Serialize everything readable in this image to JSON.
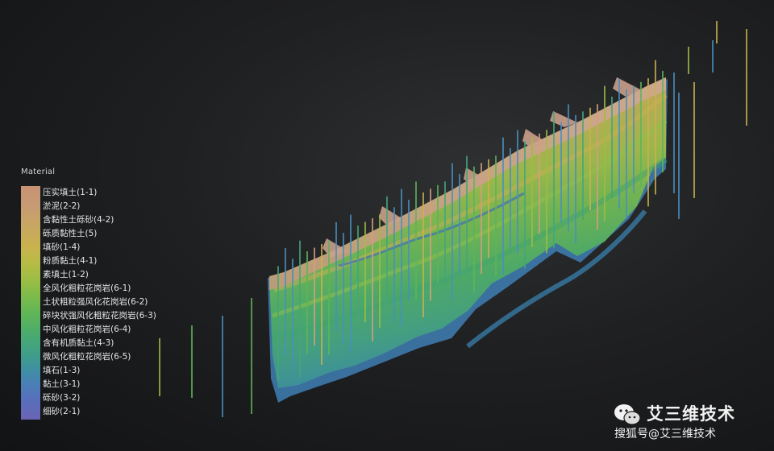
{
  "legend": {
    "title": "Material",
    "items": [
      "压实填土(1-1)",
      "淤泥(2-2)",
      "含黏性土砾砂(4-2)",
      "砾质黏性土(5)",
      "填砂(1-4)",
      "粉质黏土(4-1)",
      "素填土(1-2)",
      "全风化粗粒花岗岩(6-1)",
      "土状粗粒强风化花岗岩(6-2)",
      "碎块状强风化粗粒花岗岩(6-3)",
      "中风化粗粒花岗岩(6-4)",
      "含有机质黏土(4-3)",
      "微风化粗粒花岗岩(6-5)",
      "填石(1-3)",
      "黏土(3-1)",
      "砾砂(3-2)",
      "细砂(2-1)"
    ]
  },
  "watermark": {
    "brand": "艾三维技术",
    "sub": "搜狐号@艾三维技术",
    "logo_icon": "wechat-icon"
  },
  "scene": {
    "icon": "geological-model-3d"
  }
}
